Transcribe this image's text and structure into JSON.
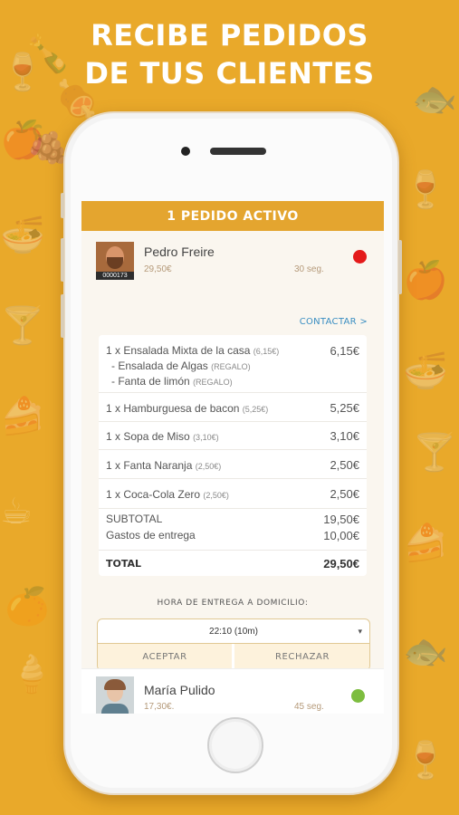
{
  "headline": {
    "line1": "RECIBE PEDIDOS",
    "line2": "DE TUS CLIENTES"
  },
  "colors": {
    "background": "#e9a92a",
    "accent": "#e4a52f",
    "status_pending": "#e41a1a",
    "status_ok": "#7dbd3f",
    "link": "#3a8ec2"
  },
  "active_bar": {
    "label": "1 PEDIDO ACTIVO"
  },
  "order": {
    "customer": {
      "name": "Pedro Freire",
      "price": "29,50€",
      "time": "30 seg.",
      "avatar_tag": "0000173"
    },
    "contact_label": "CONTACTAR >",
    "items": [
      {
        "desc": "1 x Ensalada Mixta de la casa",
        "unit": "(6,15€)",
        "price": "6,15€",
        "extras": [
          {
            "name": "- Ensalada de Algas",
            "note": "(REGALO)"
          },
          {
            "name": "- Fanta de limón",
            "note": "(REGALO)"
          }
        ]
      },
      {
        "desc": "1 x Hamburguesa de bacon",
        "unit": "(5,25€)",
        "price": "5,25€"
      },
      {
        "desc": "1 x Sopa de Miso",
        "unit": "(3,10€)",
        "price": "3,10€"
      },
      {
        "desc": "1 x Fanta Naranja",
        "unit": "(2,50€)",
        "price": "2,50€"
      },
      {
        "desc": "1 x Coca-Cola Zero",
        "unit": "(2,50€)",
        "price": "2,50€"
      }
    ],
    "subtotal_label": "SUBTOTAL",
    "subtotal": "19,50€",
    "delivery_fee_label": "Gastos de entrega",
    "delivery_fee": "10,00€",
    "total_label": "TOTAL",
    "total": "29,50€",
    "delivery_time_label": "HORA DE ENTREGA A DOMICILIO:",
    "delivery_time_value": "22:10 (10m)",
    "accept_label": "ACEPTAR",
    "reject_label": "RECHAZAR"
  },
  "second_order": {
    "customer": {
      "name": "María Pulido",
      "price": "17,30€.",
      "time": "45 seg."
    }
  },
  "icons": {
    "dropdown": "▾"
  }
}
